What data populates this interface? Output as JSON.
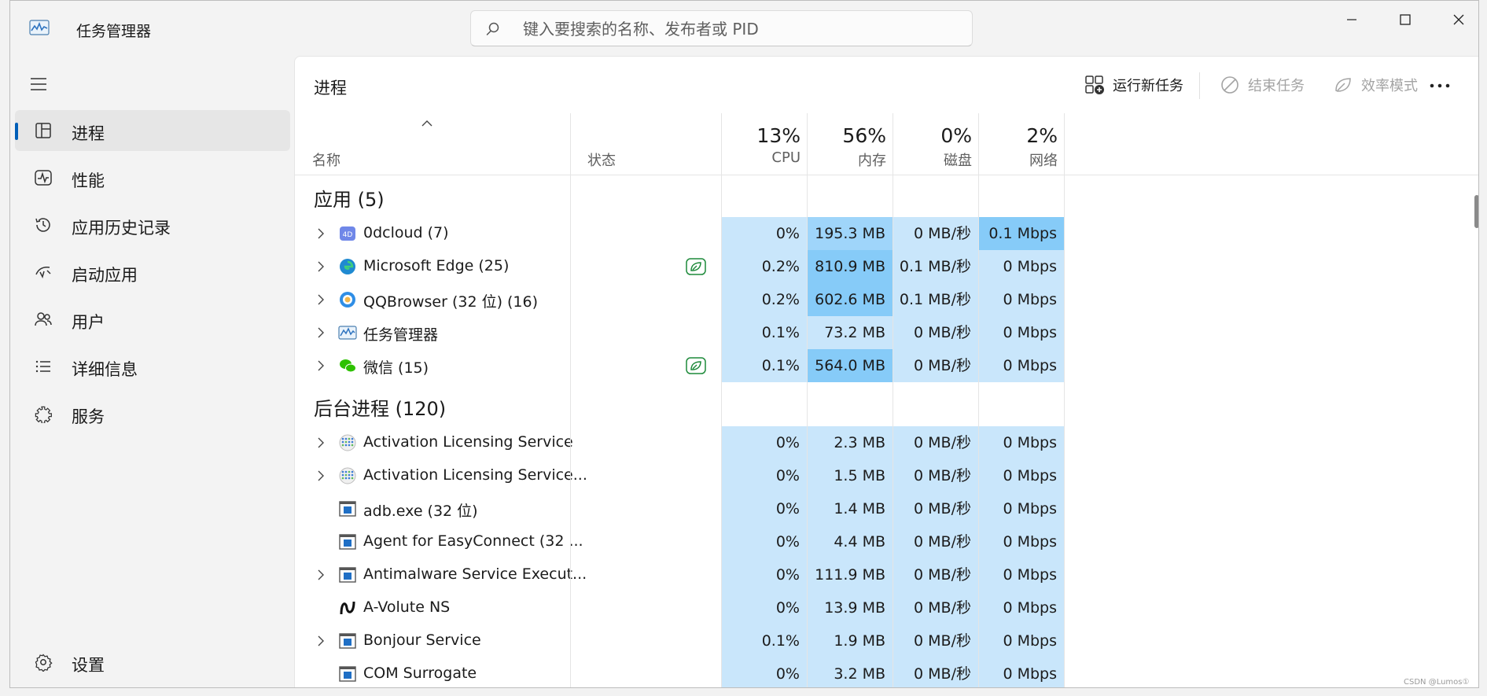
{
  "window": {
    "title": "任务管理器"
  },
  "search": {
    "placeholder": "键入要搜索的名称、发布者或 PID"
  },
  "nav": {
    "items": [
      {
        "label": "进程",
        "icon": "processes-icon",
        "active": true
      },
      {
        "label": "性能",
        "icon": "performance-icon"
      },
      {
        "label": "应用历史记录",
        "icon": "app-history-icon"
      },
      {
        "label": "启动应用",
        "icon": "startup-apps-icon"
      },
      {
        "label": "用户",
        "icon": "users-icon"
      },
      {
        "label": "详细信息",
        "icon": "details-icon"
      },
      {
        "label": "服务",
        "icon": "services-icon"
      }
    ],
    "settings": {
      "label": "设置",
      "icon": "gear-icon"
    }
  },
  "page": {
    "title": "进程"
  },
  "toolbar": {
    "run_task": "运行新任务",
    "end_task": "结束任务",
    "efficiency": "效率模式"
  },
  "columns": {
    "name": "名称",
    "status": "状态",
    "cpu": {
      "pct": "13%",
      "label": "CPU"
    },
    "memory": {
      "pct": "56%",
      "label": "内存"
    },
    "disk": {
      "pct": "0%",
      "label": "磁盘"
    },
    "network": {
      "pct": "2%",
      "label": "网络"
    }
  },
  "groups": {
    "apps": {
      "title": "应用 (5)",
      "rows": [
        {
          "name": "0dcloud (7)",
          "icon": "cloud-app-icon",
          "expandable": true,
          "eco": false,
          "cpu": "0%",
          "mem": "195.3 MB",
          "disk": "0 MB/秒",
          "net": "0.1 Mbps"
        },
        {
          "name": "Microsoft Edge (25)",
          "icon": "edge-icon",
          "expandable": true,
          "eco": true,
          "cpu": "0.2%",
          "mem": "810.9 MB",
          "disk": "0.1 MB/秒",
          "net": "0 Mbps"
        },
        {
          "name": "QQBrowser (32 位) (16)",
          "icon": "qqbrowser-icon",
          "expandable": true,
          "eco": false,
          "cpu": "0.2%",
          "mem": "602.6 MB",
          "disk": "0.1 MB/秒",
          "net": "0 Mbps"
        },
        {
          "name": "任务管理器",
          "icon": "task-manager-icon",
          "expandable": true,
          "eco": false,
          "cpu": "0.1%",
          "mem": "73.2 MB",
          "disk": "0 MB/秒",
          "net": "0 Mbps"
        },
        {
          "name": "微信 (15)",
          "icon": "wechat-icon",
          "expandable": true,
          "eco": true,
          "cpu": "0.1%",
          "mem": "564.0 MB",
          "disk": "0 MB/秒",
          "net": "0 Mbps"
        }
      ]
    },
    "background": {
      "title": "后台进程 (120)",
      "rows": [
        {
          "name": "Activation Licensing Service",
          "icon": "dots-service-icon",
          "expandable": true,
          "cpu": "0%",
          "mem": "2.3 MB",
          "disk": "0 MB/秒",
          "net": "0 Mbps"
        },
        {
          "name": "Activation Licensing Service...",
          "icon": "dots-service-icon",
          "expandable": true,
          "cpu": "0%",
          "mem": "1.5 MB",
          "disk": "0 MB/秒",
          "net": "0 Mbps"
        },
        {
          "name": "adb.exe (32 位)",
          "icon": "exe-icon",
          "expandable": false,
          "cpu": "0%",
          "mem": "1.4 MB",
          "disk": "0 MB/秒",
          "net": "0 Mbps"
        },
        {
          "name": "Agent for EasyConnect (32 ...",
          "icon": "exe-icon",
          "expandable": false,
          "cpu": "0%",
          "mem": "4.4 MB",
          "disk": "0 MB/秒",
          "net": "0 Mbps"
        },
        {
          "name": "Antimalware Service Execut...",
          "icon": "exe-icon",
          "expandable": true,
          "cpu": "0%",
          "mem": "111.9 MB",
          "disk": "0 MB/秒",
          "net": "0 Mbps"
        },
        {
          "name": "A-Volute NS",
          "icon": "avolute-icon",
          "expandable": false,
          "cpu": "0%",
          "mem": "13.9 MB",
          "disk": "0 MB/秒",
          "net": "0 Mbps"
        },
        {
          "name": "Bonjour Service",
          "icon": "exe-icon",
          "expandable": true,
          "cpu": "0.1%",
          "mem": "1.9 MB",
          "disk": "0 MB/秒",
          "net": "0 Mbps"
        },
        {
          "name": "COM Surrogate",
          "icon": "exe-icon",
          "expandable": false,
          "cpu": "0%",
          "mem": "3.2 MB",
          "disk": "0 MB/秒",
          "net": "0 Mbps"
        }
      ]
    }
  },
  "colors": {
    "heat_light": "#c9e6fb",
    "heat_mid": "#9fd5fa",
    "heat_strong": "#86cbf8",
    "accent": "#005fb8",
    "eco_green": "#1d8a3a"
  },
  "watermark": "CSDN @Lumos①"
}
